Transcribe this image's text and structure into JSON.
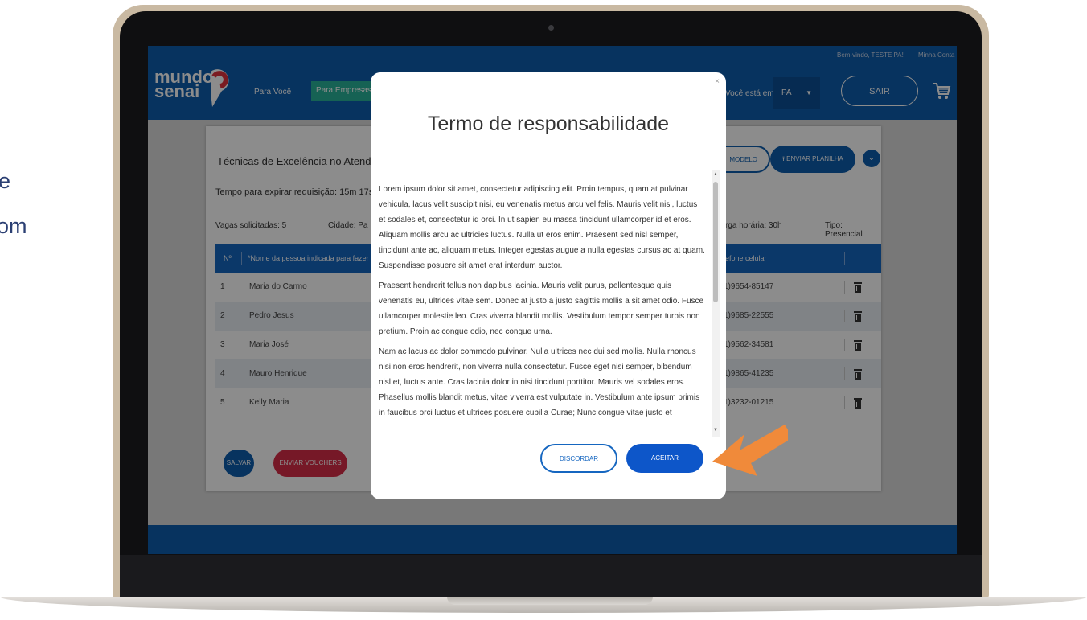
{
  "background_text": {
    "line1": "e",
    "line2": "om"
  },
  "header": {
    "logo_line1": "mundo",
    "logo_line2": "senai",
    "nav_para_voce": "Para Você",
    "nav_para_empresas": "Para Empresas",
    "welcome": "Bem-vindo, TESTE PA!",
    "account": "Minha Conta",
    "location_label": "Você está em:",
    "location_value": "PA",
    "logout": "SAIR",
    "icons": {
      "cart": "cart-icon",
      "caret": "caret-down-icon"
    }
  },
  "request": {
    "course": "Técnicas de Excelência no Atendiment",
    "timer": "Tempo para expirar requisição: 15m 17s",
    "vagas": "Vagas solicitadas: 5",
    "cidade": "Cidade: Pa",
    "carga": "rga horária: 30h",
    "tipo": "Tipo: Presencial",
    "btn_modelo": "MODELO",
    "btn_enviar": "ENVIAR PLANILHA"
  },
  "table": {
    "headers": {
      "num": "Nº",
      "name": "*Nome da pessoa indicada para fazer o c",
      "phone": "lefone celular"
    },
    "rows": [
      {
        "n": "1",
        "name": "Maria do Carmo",
        "phone": "1)9654-85147"
      },
      {
        "n": "2",
        "name": "Pedro Jesus",
        "phone": "1)9685-22555"
      },
      {
        "n": "3",
        "name": "Maria José",
        "phone": "1)9562-34581"
      },
      {
        "n": "4",
        "name": "Mauro Henrique",
        "phone": "1)9865-41235"
      },
      {
        "n": "5",
        "name": "Kelly Maria",
        "phone": "1)3232-01215"
      }
    ]
  },
  "actions": {
    "salvar": "SALVAR",
    "enviar_vouchers": "ENVIAR VOUCHERS"
  },
  "modal": {
    "close": "×",
    "title": "Termo de responsabilidade",
    "paragraphs": [
      "Lorem ipsum dolor sit amet, consectetur adipiscing elit. Proin tempus, quam at pulvinar vehicula, lacus velit suscipit nisi, eu venenatis metus arcu vel felis. Mauris velit nisl, luctus et sodales et, consectetur id orci. In ut sapien eu massa tincidunt ullamcorper id et eros. Aliquam mollis arcu ac ultricies luctus. Nulla ut eros enim. Praesent sed nisl semper, tincidunt ante ac, aliquam metus. Integer egestas augue a nulla egestas cursus ac at quam. Suspendisse posuere sit amet erat interdum auctor.",
      "Praesent hendrerit tellus non dapibus lacinia. Mauris velit purus, pellentesque quis venenatis eu, ultrices vitae sem. Donec at justo a justo sagittis mollis a sit amet odio. Fusce ullamcorper molestie leo. Cras viverra blandit mollis. Vestibulum tempor semper turpis non pretium. Proin ac congue odio, nec congue urna.",
      "Nam ac lacus ac dolor commodo pulvinar. Nulla ultrices nec dui sed mollis. Nulla rhoncus nisi non eros hendrerit, non viverra nulla consectetur. Fusce eget nisi semper, bibendum nisl et, luctus ante. Cras lacinia dolor in nisi tincidunt porttitor. Mauris vel sodales eros. Phasellus mollis blandit metus, vitae viverra est vulputate in. Vestibulum ante ipsum primis in faucibus orci luctus et ultrices posuere cubilia Curae; Nunc congue vitae justo et"
    ],
    "disagree": "DISCORDAR",
    "accept": "ACEITAR"
  },
  "colors": {
    "brand_blue": "#0e5dad",
    "accent_green": "#28b39a",
    "accent_red": "#d72d47",
    "arrow_orange": "#f08a3a"
  }
}
